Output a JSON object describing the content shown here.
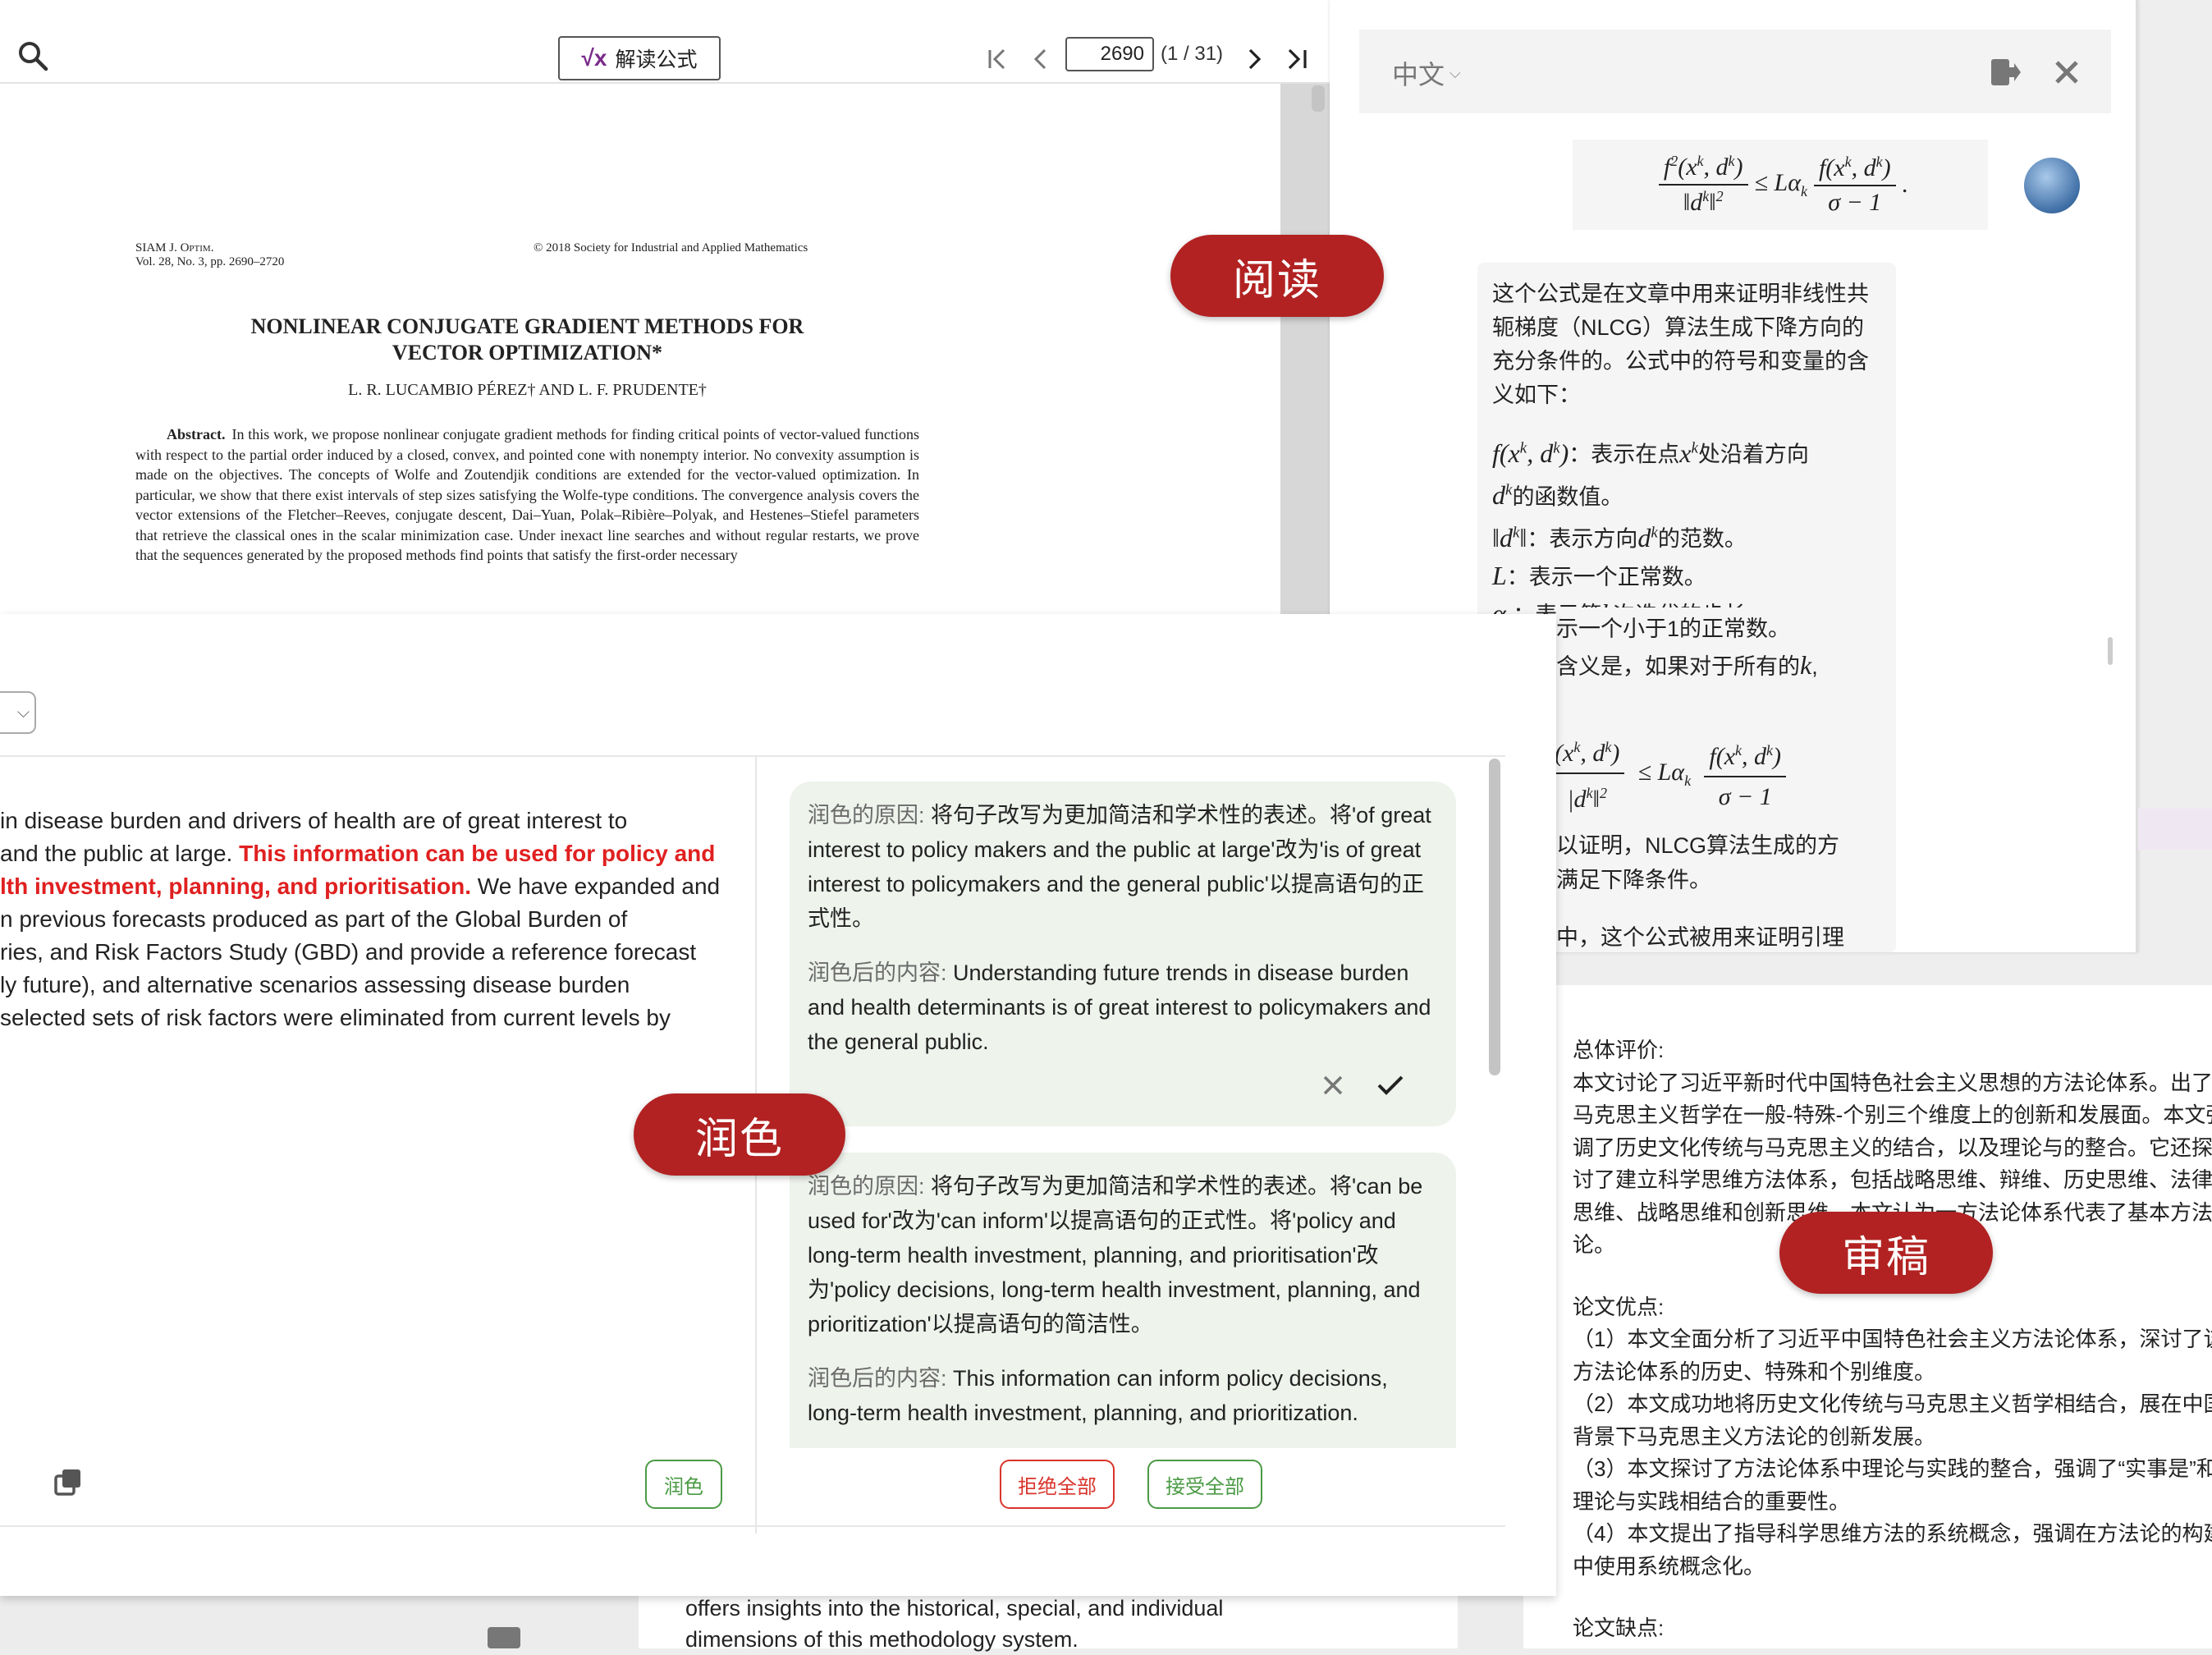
{
  "reader": {
    "formula_button": "解读公式",
    "page_input_value": "2690",
    "page_count": "(1 / 31)",
    "paper": {
      "journal_line1": "SIAM J. Optim.",
      "journal_line2": "Vol. 28, No. 3, pp. 2690–2720",
      "copyright": "© 2018 Society for Industrial and Applied Mathematics",
      "title_line1": "NONLINEAR CONJUGATE GRADIENT METHODS FOR",
      "title_line2": "VECTOR OPTIMIZATION*",
      "authors": "L. R. LUCAMBIO PÉREZ† AND L. F. PRUDENTE†",
      "abstract_label": "Abstract.",
      "abstract_body": "In this work, we propose nonlinear conjugate gradient methods for finding critical points of vector-valued functions with respect to the partial order induced by a closed, convex, and pointed cone with nonempty interior. No convexity assumption is made on the objectives. The concepts of Wolfe and Zoutendjik conditions are extended for the vector-valued optimization. In particular, we show that there exist intervals of step sizes satisfying the Wolfe-type conditions. The convergence analysis covers the vector extensions of the Fletcher–Reeves, conjugate descent, Dai–Yuan, Polak–Ribière–Polyak, and Hestenes–Stiefel parameters that retrieve the classical ones in the scalar minimization case. Under inexact line searches and without regular restarts, we prove that the sequences generated by the proposed methods find points that satisfy the first-order necessary"
    }
  },
  "chat": {
    "language": "中文",
    "intro": "这个公式是在文章中用来证明非线性共轭梯度（NLCG）算法生成下降方向的充分条件的。公式中的符号和变量的含义如下：",
    "def_f_text": "：表示在点",
    "def_f_text2": "处沿着方向",
    "def_f_text3": "的函数值。",
    "def_norm_text": "：表示方向",
    "def_norm_text2": "的范数。",
    "def_L_text": "：表示一个正常数。",
    "def_alpha_text": "：表示第",
    "def_alpha_text2": "次迭代的步长。",
    "def_sigma_partial": "示一个小于1的正常数。",
    "meaning_partial": "含义是，如果对于所有的",
    "proof_partial_1": "以证明，NLCG算法生成的方",
    "proof_partial_2": "满足下降条件。",
    "context_partial": "中，这个公式被用来证明引理"
  },
  "labels": {
    "read": "阅读",
    "polish": "润色",
    "review": "审稿"
  },
  "polish": {
    "original_seg1": "in disease burden and drivers of health are of great interest to",
    "original_seg2": " and the public at large. ",
    "original_highlight1": "This information can be used for policy and",
    "original_highlight2": "lth investment, planning, and prioritisation.",
    "original_seg3": " We have expanded and",
    "original_line4": "n previous forecasts produced as part of the Global Burden of",
    "original_line5": "ries, and Risk Factors Study (GBD) and provide a reference forecast",
    "original_line6": "ly future), and alternative scenarios assessing disease burden",
    "original_line7": "selected sets of risk factors were eliminated from current levels by",
    "polish_button": "润色",
    "reason_label": "润色的原因:",
    "result_label": "润色后的内容:",
    "suggestion1_reason": "将句子改写为更加简洁和学术性的表述。将'of great interest to policy makers and the public at large'改为'is of great interest to policymakers and the general public'以提高语句的正式性。",
    "suggestion1_result": "Understanding future trends in disease burden and health determinants is of great interest to policymakers and the general public.",
    "suggestion2_reason": "将句子改写为更加简洁和学术性的表述。将'can be used for'改为'can inform'以提高语句的正式性。将'policy and long-term health investment, planning, and prioritisation'改为'policy decisions, long-term health investment, planning, and prioritization'以提高语句的简洁性。",
    "suggestion2_result": "This information can inform policy decisions, long-term health investment, planning, and prioritization.",
    "reject_all": "拒绝全部",
    "accept_all": "接受全部"
  },
  "review": {
    "overall_label": "总体评价:",
    "overall_text": "本文讨论了习近平新时代中国特色社会主义思想的方法论体系。出了马克思主义哲学在一般-特殊-个别三个维度上的创新和发展面。本文强调了历史文化传统与马克思主义的结合，以及理论与的整合。它还探讨了建立科学思维方法体系，包括战略思维、辩维、历史思维、法律思维、战略思维和创新思维。本文认为一方法论体系代表了",
    "overall_tail": "基本方法论。",
    "strengths_label": "论文优点:",
    "strength1": "（1）本文全面分析了习近平中国特色社会主义方法论体系，深讨了该方法论体系的历史、特殊和个别维度。",
    "strength2": "（2）本文成功地将历史文化传统与马克思主义哲学相结合，展在中国背景下马克思主义方法论的创新发展。",
    "strength3": "（3）本文探讨了方法论体系中理论与实践的整合，强调了“实事是”和理论与实践相结合的重要性。",
    "strength4": "（4）本文提出了指导科学思维方法的系统概念，强调在方法论的构建中使用系统概念化。",
    "weakness_label": "论文缺点:"
  },
  "bottom": {
    "line1": "offers insights into the historical, special, and individual",
    "line2": "dimensions of this methodology system."
  }
}
